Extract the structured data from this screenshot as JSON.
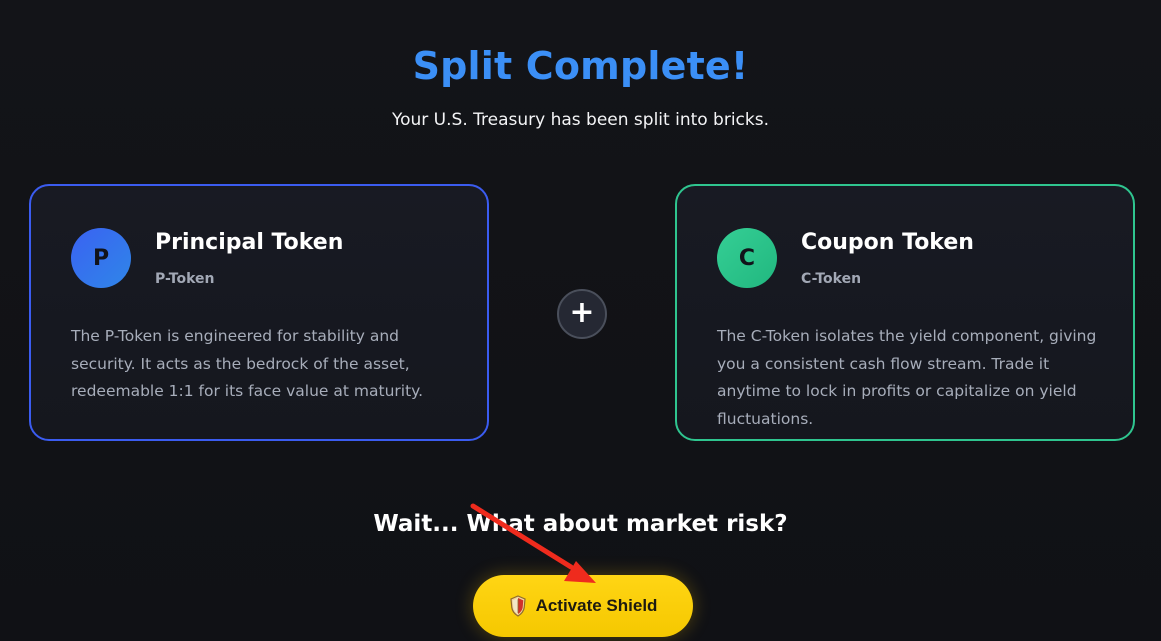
{
  "header": {
    "title": "Split Complete!",
    "subtitle": "Your U.S. Treasury has been split into bricks."
  },
  "cards": [
    {
      "badge": "P",
      "title": "Principal Token",
      "subtitle": "P-Token",
      "description": "The P-Token is engineered for stability and security. It acts as the bedrock of the asset, redeemable 1:1 for its face value at maturity."
    },
    {
      "badge": "C",
      "title": "Coupon Token",
      "subtitle": "C-Token",
      "description": "The C-Token isolates the yield component, giving you a consistent cash flow stream. Trade it anytime to lock in profits or capitalize on yield fluctuations."
    }
  ],
  "combine": {
    "symbol": "+"
  },
  "cta": {
    "question": "Wait... What about market risk?",
    "button_label": "Activate Shield",
    "icon": "shield-icon"
  },
  "colors": {
    "title": "#3b8ff6",
    "principal_border": "#3b5cf0",
    "coupon_border": "#2fc58f",
    "button": "#f5c800",
    "annotation_arrow": "#ef2b1d"
  }
}
